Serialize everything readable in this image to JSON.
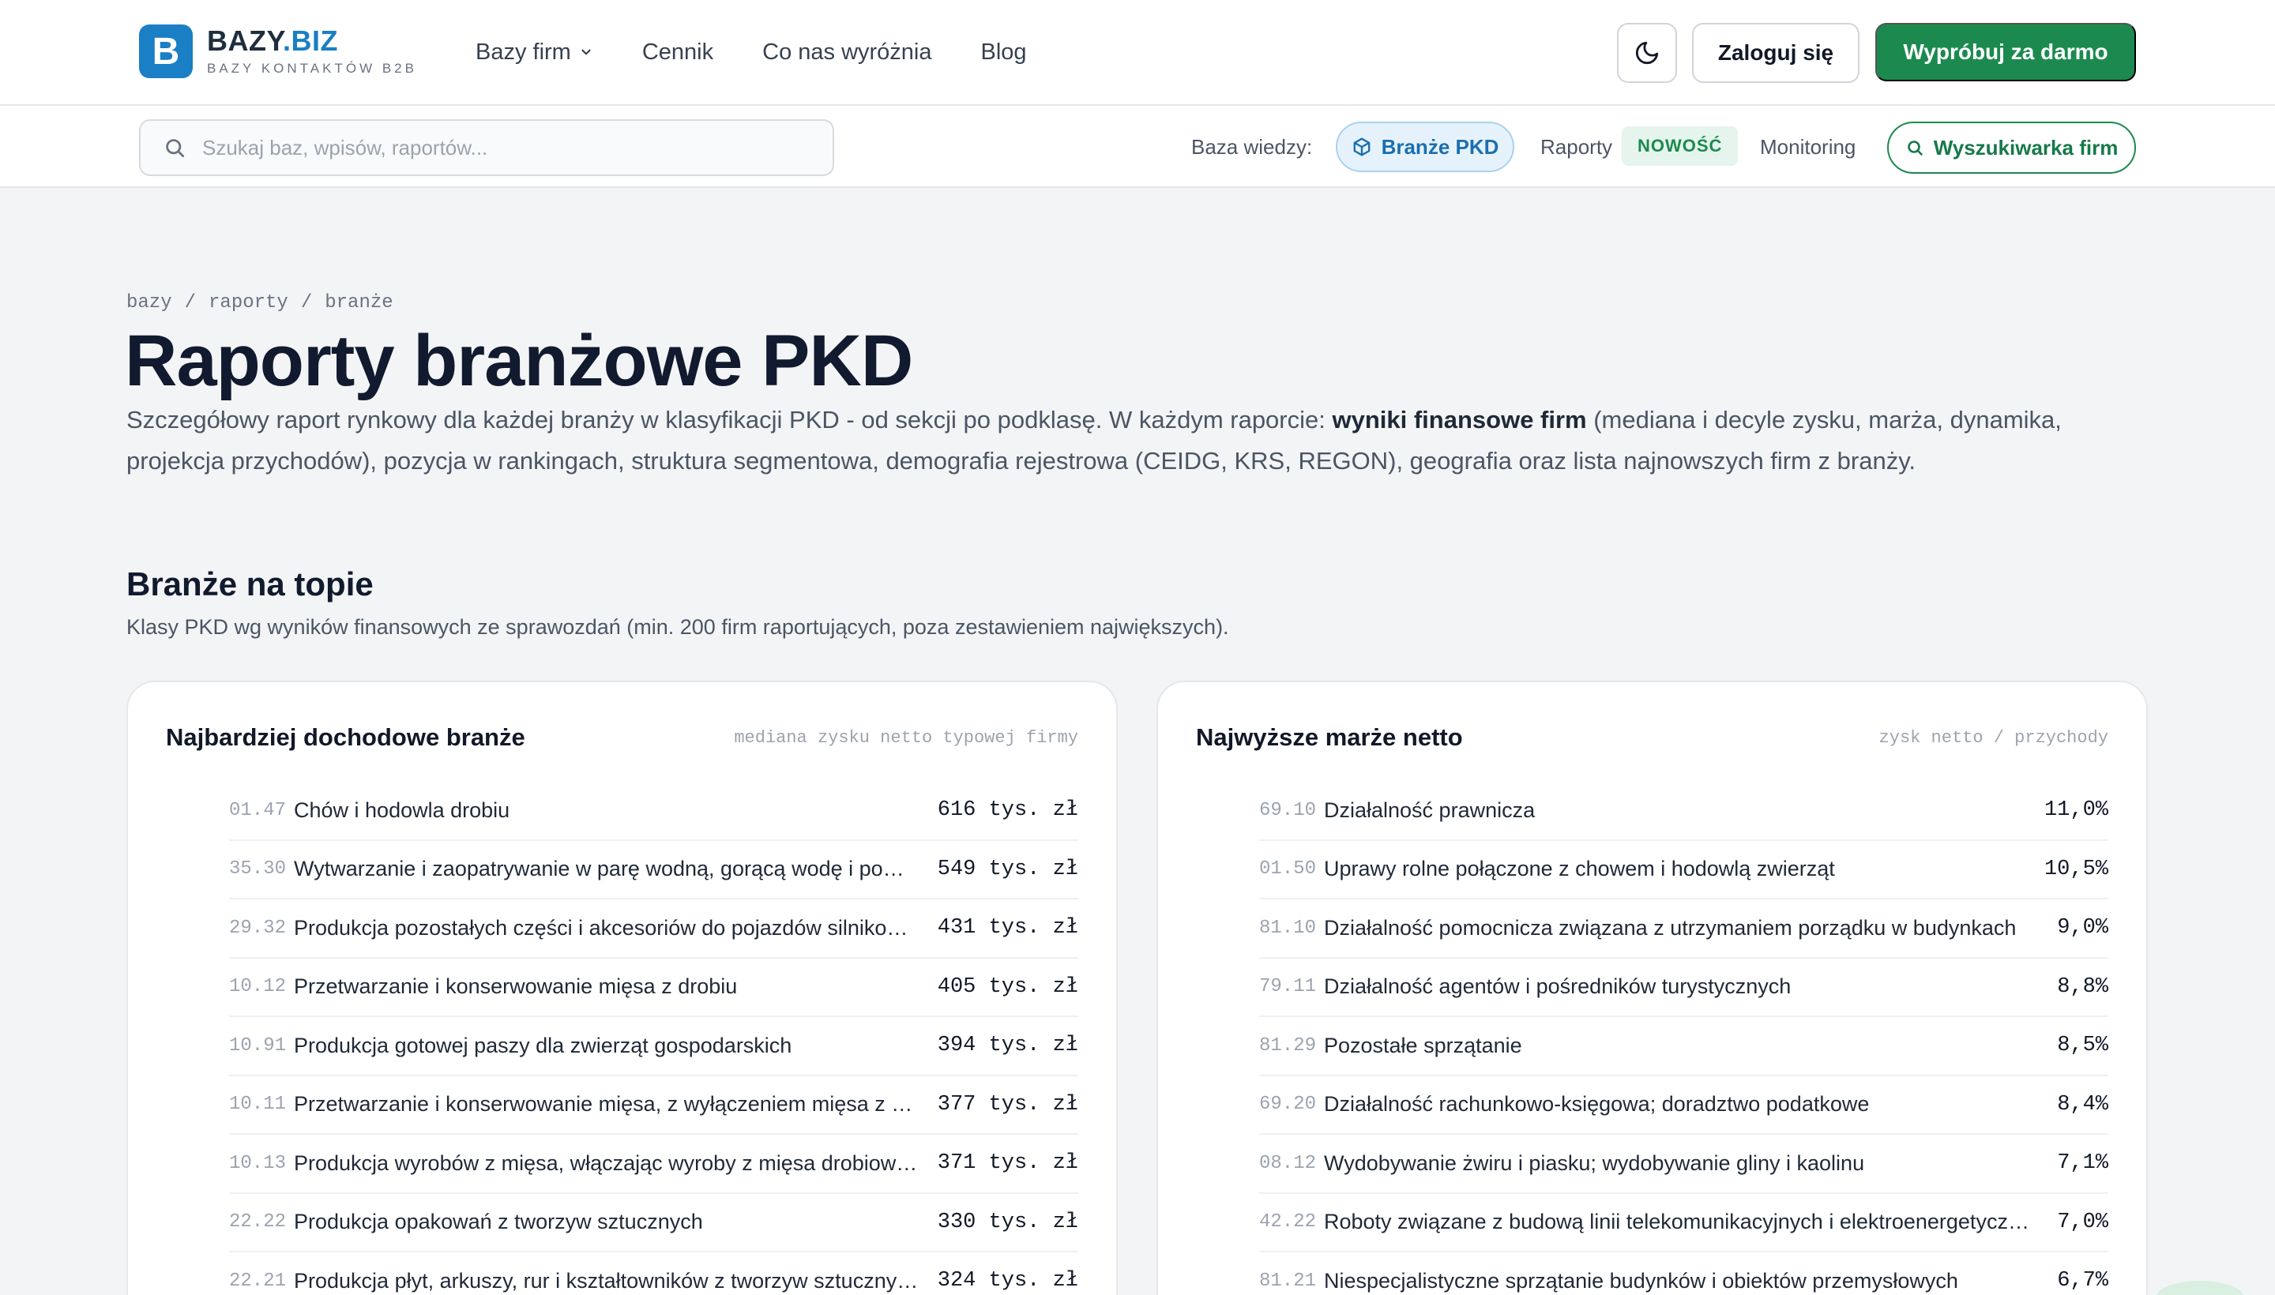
{
  "header": {
    "logo_letter": "B",
    "logo_name": "BAZY",
    "logo_tld": ".BIZ",
    "logo_sub": "BAZY KONTAKTÓW B2B",
    "nav": [
      "Bazy firm",
      "Cennik",
      "Co nas wyróżnia",
      "Blog"
    ],
    "login_label": "Zaloguj się",
    "try_label": "Wypróbuj za darmo"
  },
  "subbar": {
    "search_placeholder": "Szukaj baz, wpisów, raportów...",
    "kb_label": "Baza wiedzy:",
    "pkd_label": "Branże PKD",
    "raporty_label": "Raporty",
    "new_badge": "NOWOŚĆ",
    "monitoring_label": "Monitoring",
    "finder_label": "Wyszukiwarka firm"
  },
  "breadcrumb": [
    "bazy",
    "raporty",
    "branże"
  ],
  "hero": {
    "title": "Raporty branżowe PKD",
    "lead_a": "Szczegółowy raport rynkowy dla każdej branży w klasyfikacji PKD - od sekcji po podklasę. W każdym raporcie: ",
    "lead_bold": "wyniki finansowe firm",
    "lead_b": " (mediana i decyle zysku, marża, dynamika, projekcja przychodów), pozycja w rankingach, struktura segmentowa, demografia rejestrowa (CEIDG, KRS, REGON), geografia oraz lista najnowszych firm z branży."
  },
  "section": {
    "title": "Branże na topie",
    "subtitle": "Klasy PKD wg wyników finansowych ze sprawozdań (min. 200 firm raportujących, poza zestawieniem największych)."
  },
  "cards": [
    {
      "title": "Najbardziej dochodowe branże",
      "note": "mediana zysku netto typowej firmy",
      "rows": [
        {
          "code": "01.47",
          "name": "Chów i hodowla drobiu",
          "value": "616 tys. zł"
        },
        {
          "code": "35.30",
          "name": "Wytwarzanie i zaopatrywanie w parę wodną, gorącą wodę i powietrze do układów klimatyzacyjnych",
          "value": "549 tys. zł"
        },
        {
          "code": "29.32",
          "name": "Produkcja pozostałych części i akcesoriów do pojazdów silnikowych, z wyłączeniem motocykli",
          "value": "431 tys. zł"
        },
        {
          "code": "10.12",
          "name": "Przetwarzanie i konserwowanie mięsa z drobiu",
          "value": "405 tys. zł"
        },
        {
          "code": "10.91",
          "name": "Produkcja gotowej paszy dla zwierząt gospodarskich",
          "value": "394 tys. zł"
        },
        {
          "code": "10.11",
          "name": "Przetwarzanie i konserwowanie mięsa, z wyłączeniem mięsa z drobiu",
          "value": "377 tys. zł"
        },
        {
          "code": "10.13",
          "name": "Produkcja wyrobów z mięsa, włączając wyroby z mięsa drobiowego",
          "value": "371 tys. zł"
        },
        {
          "code": "22.22",
          "name": "Produkcja opakowań z tworzyw sztucznych",
          "value": "330 tys. zł"
        },
        {
          "code": "22.21",
          "name": "Produkcja płyt, arkuszy, rur i kształtowników z tworzyw sztucznych",
          "value": "324 tys. zł"
        }
      ]
    },
    {
      "title": "Najwyższe marże netto",
      "note": "zysk netto / przychody",
      "rows": [
        {
          "code": "69.10",
          "name": "Działalność prawnicza",
          "value": "11,0%"
        },
        {
          "code": "01.50",
          "name": "Uprawy rolne połączone z chowem i hodowlą zwierząt",
          "value": "10,5%"
        },
        {
          "code": "81.10",
          "name": "Działalność pomocnicza związana z utrzymaniem porządku w budynkach",
          "value": "9,0%"
        },
        {
          "code": "79.11",
          "name": "Działalność agentów i pośredników turystycznych",
          "value": "8,8%"
        },
        {
          "code": "81.29",
          "name": "Pozostałe sprzątanie",
          "value": "8,5%"
        },
        {
          "code": "69.20",
          "name": "Działalność rachunkowo-księgowa; doradztwo podatkowe",
          "value": "8,4%"
        },
        {
          "code": "08.12",
          "name": "Wydobywanie żwiru i piasku; wydobywanie gliny i kaolinu",
          "value": "7,1%"
        },
        {
          "code": "42.22",
          "name": "Roboty związane z budową linii telekomunikacyjnych i elektroenergetycznych",
          "value": "7,0%"
        },
        {
          "code": "81.21",
          "name": "Niespecjalistyczne sprzątanie budynków i obiektów przemysłowych",
          "value": "6,7%"
        }
      ]
    }
  ]
}
